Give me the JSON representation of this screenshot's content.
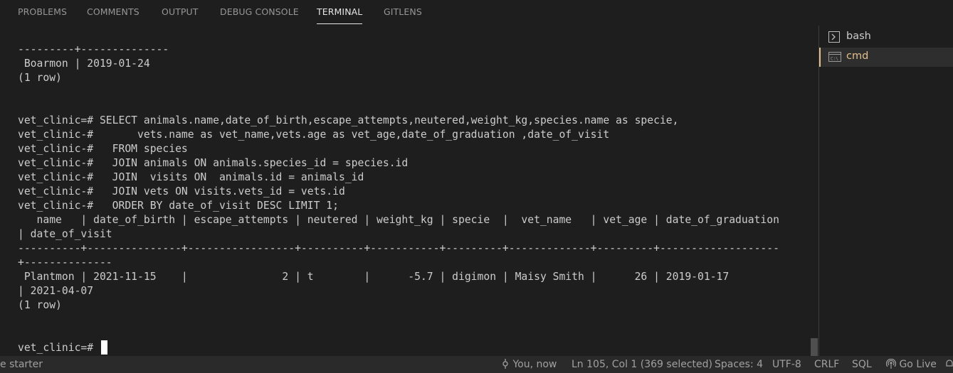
{
  "panel": {
    "tabs": [
      "PROBLEMS",
      "COMMENTS",
      "OUTPUT",
      "DEBUG CONSOLE",
      "TERMINAL",
      "GITLENS"
    ],
    "active_tab": "TERMINAL"
  },
  "terminal": {
    "lines": [
      "---------+--------------",
      " Boarmon | 2019-01-24",
      "(1 row)",
      "",
      "",
      "vet_clinic=# SELECT animals.name,date_of_birth,escape_attempts,neutered,weight_kg,species.name as specie,",
      "vet_clinic-#       vets.name as vet_name,vets.age as vet_age,date_of_graduation ,date_of_visit",
      "vet_clinic-#   FROM species",
      "vet_clinic-#   JOIN animals ON animals.species_id = species.id",
      "vet_clinic-#   JOIN  visits ON  animals.id = animals_id",
      "vet_clinic-#   JOIN vets ON visits.vets_id = vets.id",
      "vet_clinic-#   ORDER BY date_of_visit DESC LIMIT 1;",
      "   name   | date_of_birth | escape_attempts | neutered | weight_kg | specie  |  vet_name   | vet_age | date_of_graduation",
      "| date_of_visit",
      "----------+---------------+-----------------+----------+-----------+---------+-------------+---------+-------------------",
      "+--------------",
      " Plantmon | 2021-11-15    |               2 | t        |      -5.7 | digimon | Maisy Smith |      26 | 2019-01-17",
      "| 2021-04-07",
      "(1 row)",
      "",
      "",
      "vet_clinic=# "
    ]
  },
  "side_panel": {
    "terminals": [
      {
        "label": "bash",
        "icon": "terminal-icon",
        "active": false
      },
      {
        "label": "cmd",
        "icon": "cmd-icon",
        "active": true
      }
    ]
  },
  "status_bar": {
    "left": "e starter",
    "author": "You, now",
    "position": "Ln 105, Col 1 (369 selected)",
    "spaces": "Spaces: 4",
    "encoding": "UTF-8",
    "eol": "CRLF",
    "language": "SQL",
    "live": "Go Live"
  },
  "colors": {
    "background": "#1e1e1e",
    "accent": "#e2c08d",
    "text": "#cccccc"
  }
}
